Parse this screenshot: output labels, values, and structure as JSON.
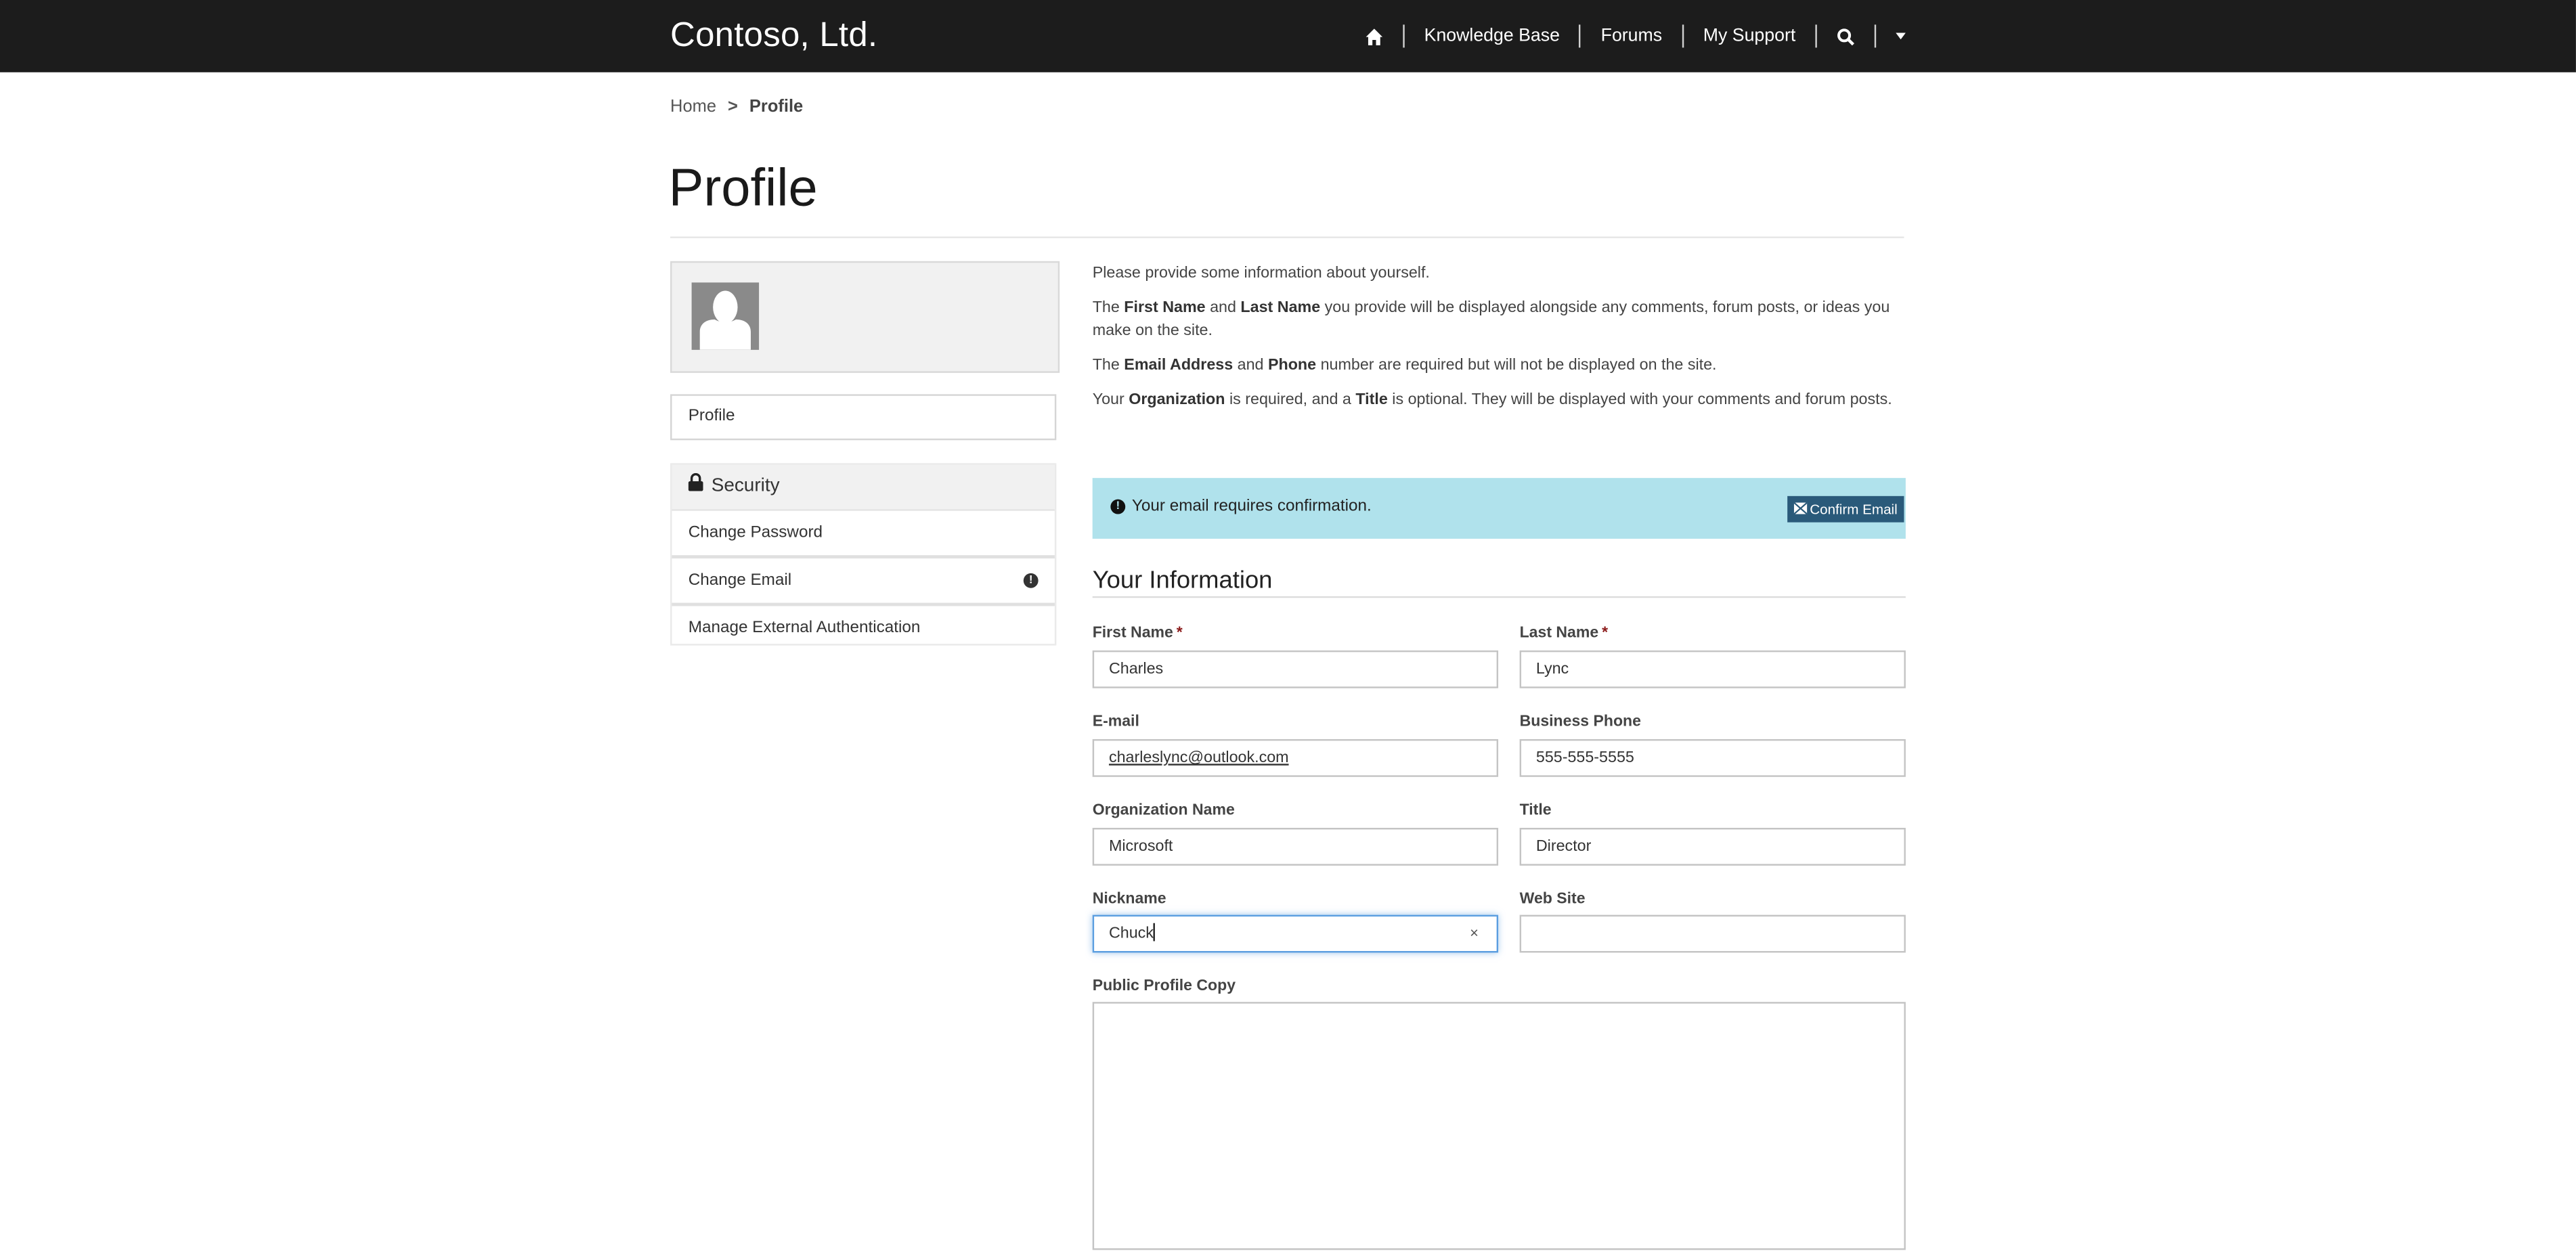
{
  "header": {
    "brand": "Contoso, Ltd.",
    "nav": [
      {
        "label": "",
        "icon": "home-icon"
      },
      {
        "label": "Knowledge Base"
      },
      {
        "label": "Forums"
      },
      {
        "label": "My Support"
      },
      {
        "label": "",
        "icon": "search-icon"
      },
      {
        "label": "",
        "icon": "caret-down-icon"
      }
    ]
  },
  "breadcrumb": {
    "home": "Home",
    "separator": ">",
    "current": "Profile"
  },
  "page": {
    "title": "Profile"
  },
  "sidebar": {
    "profile_link": "Profile",
    "security": {
      "heading": "Security",
      "items": [
        {
          "label": "Change Password"
        },
        {
          "label": "Change Email",
          "badge": "!"
        },
        {
          "label": "Manage External Authentication"
        }
      ]
    }
  },
  "intro": {
    "p1": "Please provide some information about yourself.",
    "p2": {
      "a": "The ",
      "b1": "First Name",
      "c": " and ",
      "b2": "Last Name",
      "d": " you provide will be displayed alongside any comments, forum posts, or ideas you make on the site."
    },
    "p3": {
      "a": "The ",
      "b1": "Email Address",
      "c": " and ",
      "b2": "Phone",
      "d": " number are required but will not be displayed on the site."
    },
    "p4": {
      "a": "Your ",
      "b1": "Organization",
      "c": " is required, and a ",
      "b2": "Title",
      "d": " is optional. They will be displayed with your comments and forum posts."
    }
  },
  "alert": {
    "icon_glyph": "!",
    "message": "Your email requires confirmation.",
    "button": "Confirm Email",
    "background": "#b0e2ec",
    "button_color": "#2a5a7a"
  },
  "form": {
    "section_title": "Your Information",
    "required_marker": "*",
    "first_name": {
      "label": "First Name",
      "value": "Charles"
    },
    "last_name": {
      "label": "Last Name",
      "value": "Lync"
    },
    "email": {
      "label": "E-mail",
      "value": "charleslync@outlook.com"
    },
    "phone": {
      "label": "Business Phone",
      "value": "555-555-5555"
    },
    "organization": {
      "label": "Organization Name",
      "value": "Microsoft"
    },
    "title": {
      "label": "Title",
      "value": "Director"
    },
    "nickname": {
      "label": "Nickname",
      "value": "Chuck",
      "clear": "×"
    },
    "website": {
      "label": "Web Site",
      "value": ""
    },
    "public_profile": {
      "label": "Public Profile Copy",
      "value": ""
    }
  }
}
